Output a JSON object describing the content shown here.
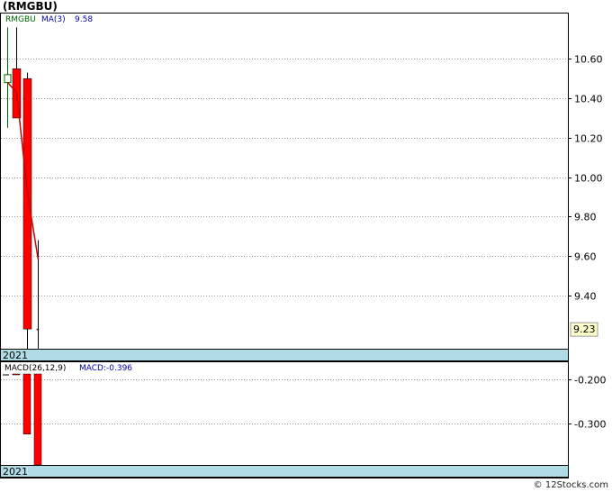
{
  "title": "(RMGBU)",
  "footer": "© 12Stocks.com",
  "colors": {
    "up": "#00aa00",
    "down": "#ff0000",
    "ma": "#cc0000",
    "date_band": "#b0dce6",
    "grid": "#999999"
  },
  "chart_data": [
    {
      "type": "candlestick",
      "symbol_label": "RMGBU",
      "ma_label": "MA(3)",
      "ma_value_label": "9.58",
      "last_price_label": "9.23",
      "period_label": "2021",
      "ylim": [
        9.13,
        10.83
      ],
      "yticks": [
        10.6,
        10.4,
        10.2,
        10.0,
        9.8,
        9.6,
        9.4
      ],
      "ytick_labels": [
        "10.60",
        "10.40",
        "10.20",
        "10.00",
        "9.80",
        "9.60",
        "9.40"
      ],
      "last_price": 9.23,
      "candles": [
        {
          "open": 10.48,
          "close": 10.52,
          "high": 10.76,
          "low": 10.25,
          "direction": "up"
        },
        {
          "open": 10.55,
          "close": 10.3,
          "high": 10.76,
          "low": 10.3,
          "direction": "down"
        },
        {
          "open": 10.5,
          "close": 9.23,
          "high": 10.53,
          "low": 9.13,
          "direction": "down"
        },
        {
          "open": 9.23,
          "close": 9.23,
          "high": 9.68,
          "low": 9.13,
          "direction": "down"
        }
      ],
      "ma_series": [
        10.48,
        10.43,
        9.92,
        9.58
      ]
    },
    {
      "type": "bar",
      "indicator_label": "MACD(26,12,9)",
      "indicator_value_label": "MACD:-0.396",
      "period_label": "2021",
      "ylim": [
        -0.396,
        -0.16
      ],
      "yticks": [
        -0.2,
        -0.3
      ],
      "ytick_labels": [
        "-0.200",
        "-0.300"
      ],
      "values": [
        -0.165,
        -0.185,
        -0.325,
        -0.396
      ]
    }
  ]
}
